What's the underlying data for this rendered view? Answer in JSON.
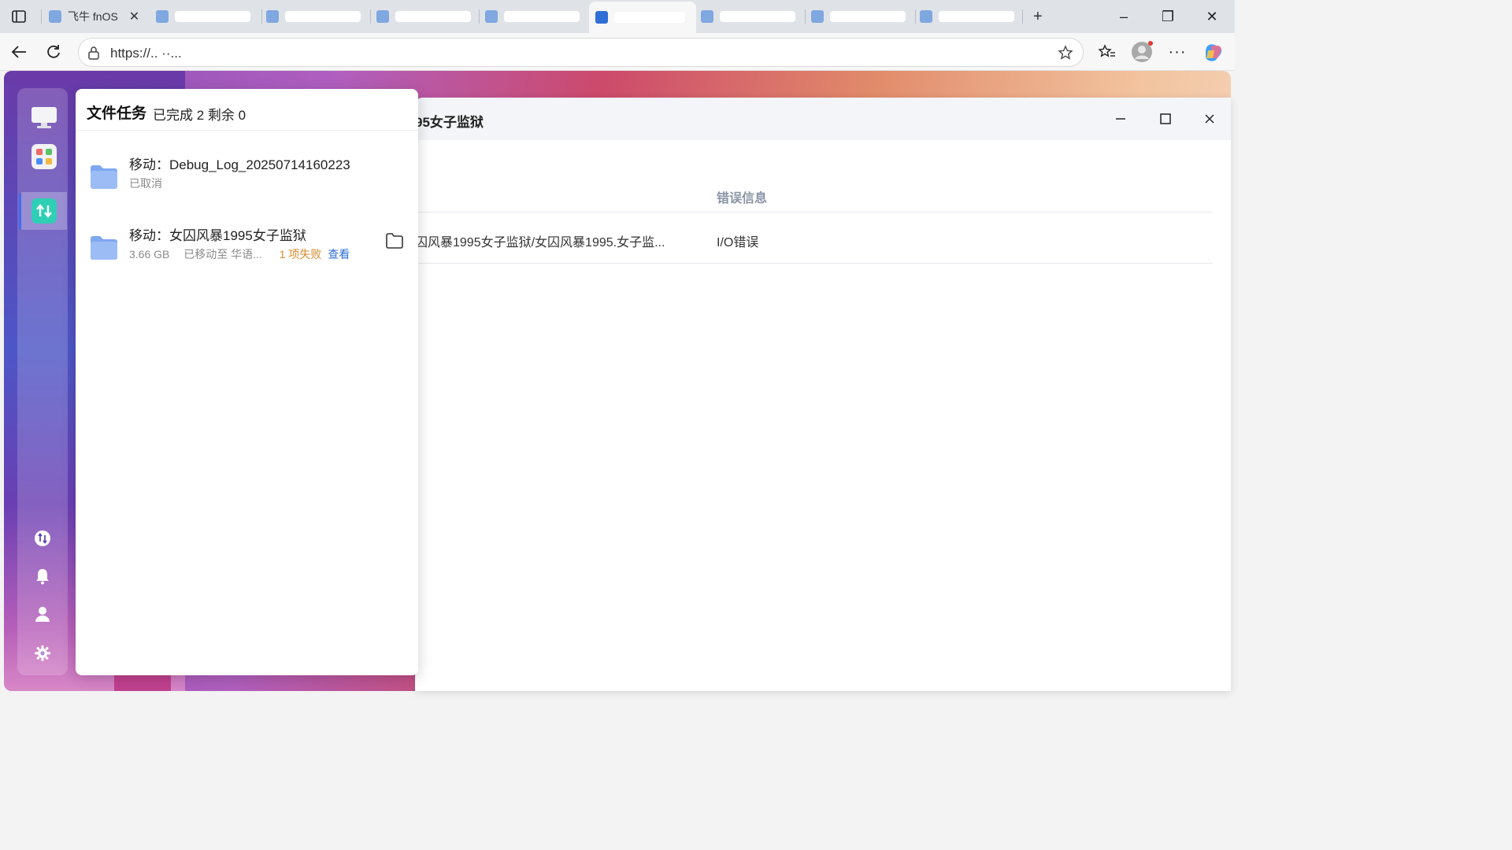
{
  "browser": {
    "tabs": [
      {
        "label": "飞牛 fnOS"
      }
    ],
    "url": "https://..  ··...",
    "window_controls": {
      "minimize": "–",
      "restore": "❐",
      "close": "✕"
    }
  },
  "main_window": {
    "title": "95女子监狱",
    "columns": {
      "error_info": "错误信息"
    },
    "rows": [
      {
        "path": "囚风暴1995女子监狱/女囚风暴1995.女子监...",
        "error": "I/O错误"
      }
    ]
  },
  "task_panel": {
    "title": "文件任务",
    "summary": "已完成 2 剩余 0",
    "tasks": [
      {
        "name": "移动：Debug_Log_20250714160223",
        "status": "已取消"
      },
      {
        "name": "移动：女囚风暴1995女子监狱",
        "size": "3.66 GB",
        "dest": "已移动至 华语...",
        "failed": "1 项失败",
        "view": "查看"
      }
    ]
  },
  "colors": {
    "accent": "#3f6df0",
    "warning": "#d98a2b",
    "link": "#2f6fd6",
    "folder": "#7ea8f0"
  }
}
